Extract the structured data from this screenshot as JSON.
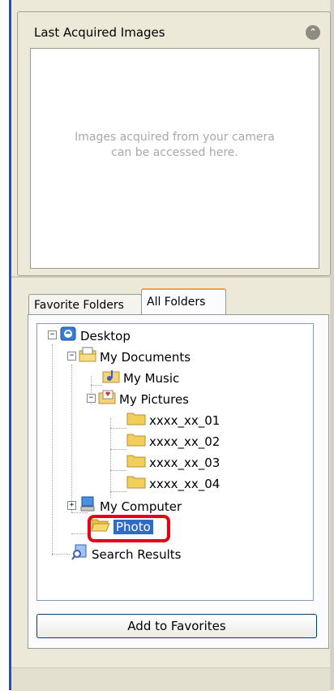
{
  "last_acquired": {
    "title": "Last Acquired Images",
    "collapse_icon": "double-chevron-up-icon",
    "message_line1": "Images acquired from your camera",
    "message_line2": "can be accessed here."
  },
  "tabs": [
    {
      "label": "Favorite Folders",
      "active": false
    },
    {
      "label": "All Folders",
      "active": true
    }
  ],
  "tree": {
    "desktop": "Desktop",
    "my_documents": "My Documents",
    "my_music": "My Music",
    "my_pictures": "My Pictures",
    "folders": [
      "xxxx_xx_01",
      "xxxx_xx_02",
      "xxxx_xx_03",
      "xxxx_xx_04"
    ],
    "my_computer": "My Computer",
    "photo": "Photo",
    "search_results": "Search Results",
    "selected": "Photo",
    "highlight_color": "#e60012",
    "selection_color": "#316ac5"
  },
  "add_button": "Add to Favorites"
}
